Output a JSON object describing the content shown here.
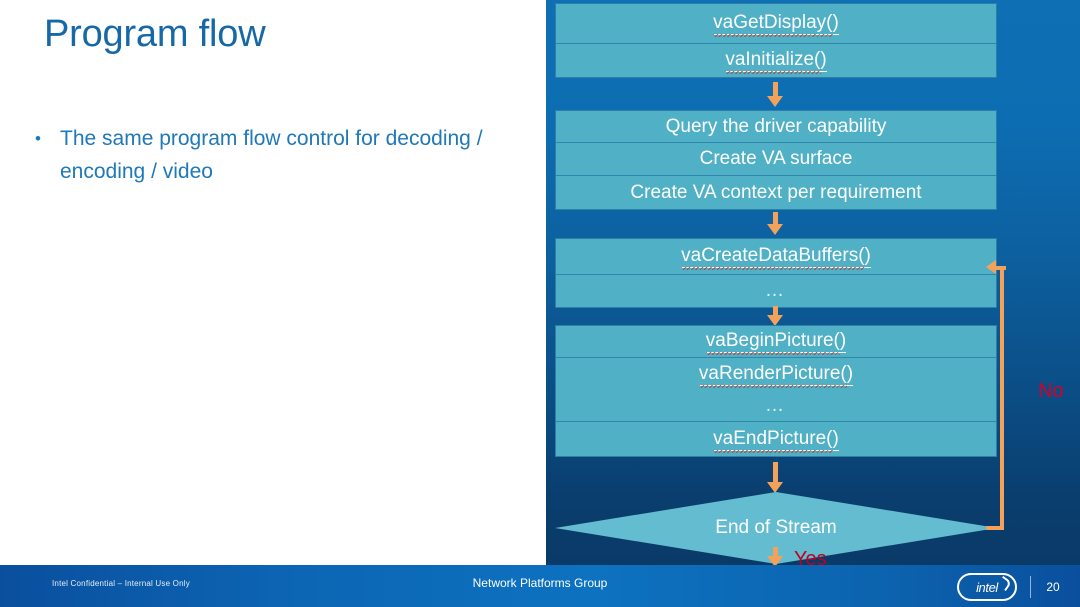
{
  "slide": {
    "title": "Program flow",
    "bullet_marker": "•",
    "bullet_text": "The same program flow control for decoding / encoding / video",
    "title_color": "#1668a7",
    "body_color": "#1f78b8"
  },
  "flowchart": {
    "accent_box_color": "#4fb0c6",
    "arrow_color": "#f4a25a",
    "panel_gradient_top": "#0f6fb4",
    "panel_gradient_bottom": "#0a3a68",
    "groups": [
      {
        "id": "init-group",
        "rows": [
          {
            "text": "vaGetDisplay()",
            "code": true
          },
          {
            "text": "vaInitialize()",
            "code": true
          }
        ]
      },
      {
        "id": "setup-group",
        "rows": [
          {
            "text": "Query the driver capability",
            "code": false
          },
          {
            "text": "Create VA surface",
            "code": false
          },
          {
            "text": "Create VA context per requirement",
            "code": false
          }
        ]
      },
      {
        "id": "buffers-group",
        "rows": [
          {
            "text": "vaCreateDataBuffers()",
            "code": true
          },
          {
            "text": "…",
            "code": false
          }
        ]
      },
      {
        "id": "picture-group",
        "rows": [
          {
            "text": "vaBeginPicture()",
            "code": true
          },
          {
            "text": "vaRenderPicture()",
            "code": true
          },
          {
            "text": "…",
            "code": false
          },
          {
            "text": "vaEndPicture()",
            "code": true
          }
        ]
      }
    ],
    "decision": {
      "label": "End of Stream",
      "no_label": "No",
      "yes_label": "Yes",
      "no_color": "#d3002a",
      "yes_color": "#c00020"
    }
  },
  "footer": {
    "confidential": "Intel Confidential – Internal Use Only",
    "group": "Network Platforms Group",
    "logo_text": "intel",
    "page_number": "20"
  }
}
